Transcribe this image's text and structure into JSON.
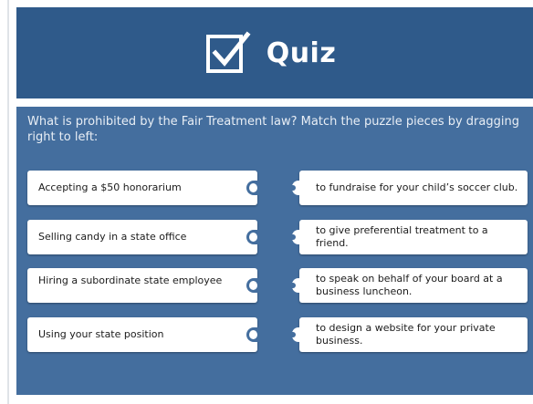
{
  "header": {
    "title": "Quiz",
    "icon": "checkbox-check-icon"
  },
  "question": "What is prohibited by the Fair Treatment law?  Match the puzzle pieces by dragging right to left:",
  "left_pieces": [
    {
      "label": "Accepting a $50 honorarium"
    },
    {
      "label": "Selling candy  in a state office"
    },
    {
      "label": "Hiring a subordinate state employee"
    },
    {
      "label": "Using your state position"
    }
  ],
  "right_pieces": [
    {
      "label": "to fundraise for your child’s soccer club."
    },
    {
      "label": "to give preferential treatment to a friend."
    },
    {
      "label": "to speak on behalf of your board at a business luncheon."
    },
    {
      "label": "to design a website for your private business."
    }
  ],
  "colors": {
    "header_bg": "#2f5a8a",
    "panel_bg": "#446e9e",
    "piece_bg": "#ffffff"
  }
}
